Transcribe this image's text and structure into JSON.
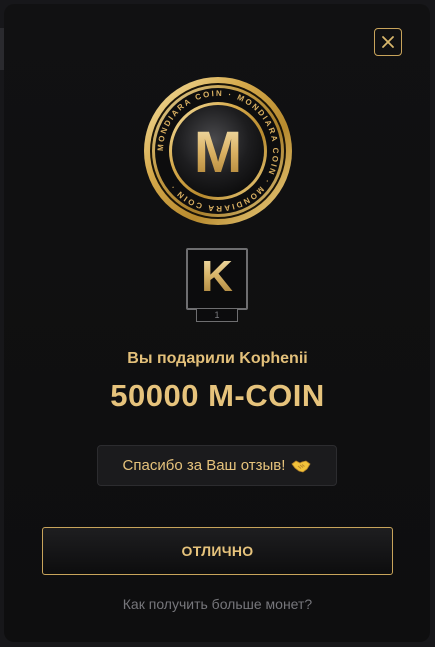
{
  "modal": {
    "coin_ring_text": "MONDIARA COIN · MONDIARA COIN · MONDIARA COIN ·",
    "coin_letter": "M",
    "recipient_avatar_letter": "K",
    "recipient_level": "1",
    "gift_message": "Вы подарили Kophenii",
    "amount_text": "50000 M-COIN",
    "thanks_text": "Спасибо за Ваш отзыв!",
    "ok_button_label": "ОТЛИЧНО",
    "how_to_link": "Как получить больше монет?"
  },
  "icons": {
    "close": "close-icon",
    "handshake": "handshake-icon",
    "coin": "coin-icon"
  },
  "colors": {
    "accent_gold": "#e6c37c",
    "border_gold": "#c8a45b",
    "background": "#0e0e0f",
    "muted_text": "#76767b"
  }
}
